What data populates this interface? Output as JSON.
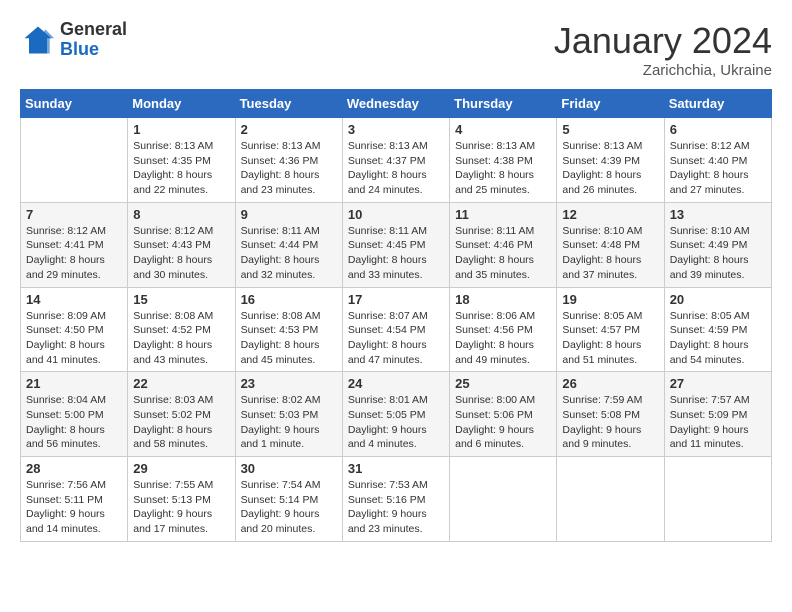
{
  "logo": {
    "general": "General",
    "blue": "Blue"
  },
  "header": {
    "title": "January 2024",
    "subtitle": "Zarichchia, Ukraine"
  },
  "weekdays": [
    "Sunday",
    "Monday",
    "Tuesday",
    "Wednesday",
    "Thursday",
    "Friday",
    "Saturday"
  ],
  "weeks": [
    [
      {
        "day": "",
        "info": ""
      },
      {
        "day": "1",
        "info": "Sunrise: 8:13 AM\nSunset: 4:35 PM\nDaylight: 8 hours\nand 22 minutes."
      },
      {
        "day": "2",
        "info": "Sunrise: 8:13 AM\nSunset: 4:36 PM\nDaylight: 8 hours\nand 23 minutes."
      },
      {
        "day": "3",
        "info": "Sunrise: 8:13 AM\nSunset: 4:37 PM\nDaylight: 8 hours\nand 24 minutes."
      },
      {
        "day": "4",
        "info": "Sunrise: 8:13 AM\nSunset: 4:38 PM\nDaylight: 8 hours\nand 25 minutes."
      },
      {
        "day": "5",
        "info": "Sunrise: 8:13 AM\nSunset: 4:39 PM\nDaylight: 8 hours\nand 26 minutes."
      },
      {
        "day": "6",
        "info": "Sunrise: 8:12 AM\nSunset: 4:40 PM\nDaylight: 8 hours\nand 27 minutes."
      }
    ],
    [
      {
        "day": "7",
        "info": "Sunrise: 8:12 AM\nSunset: 4:41 PM\nDaylight: 8 hours\nand 29 minutes."
      },
      {
        "day": "8",
        "info": "Sunrise: 8:12 AM\nSunset: 4:43 PM\nDaylight: 8 hours\nand 30 minutes."
      },
      {
        "day": "9",
        "info": "Sunrise: 8:11 AM\nSunset: 4:44 PM\nDaylight: 8 hours\nand 32 minutes."
      },
      {
        "day": "10",
        "info": "Sunrise: 8:11 AM\nSunset: 4:45 PM\nDaylight: 8 hours\nand 33 minutes."
      },
      {
        "day": "11",
        "info": "Sunrise: 8:11 AM\nSunset: 4:46 PM\nDaylight: 8 hours\nand 35 minutes."
      },
      {
        "day": "12",
        "info": "Sunrise: 8:10 AM\nSunset: 4:48 PM\nDaylight: 8 hours\nand 37 minutes."
      },
      {
        "day": "13",
        "info": "Sunrise: 8:10 AM\nSunset: 4:49 PM\nDaylight: 8 hours\nand 39 minutes."
      }
    ],
    [
      {
        "day": "14",
        "info": "Sunrise: 8:09 AM\nSunset: 4:50 PM\nDaylight: 8 hours\nand 41 minutes."
      },
      {
        "day": "15",
        "info": "Sunrise: 8:08 AM\nSunset: 4:52 PM\nDaylight: 8 hours\nand 43 minutes."
      },
      {
        "day": "16",
        "info": "Sunrise: 8:08 AM\nSunset: 4:53 PM\nDaylight: 8 hours\nand 45 minutes."
      },
      {
        "day": "17",
        "info": "Sunrise: 8:07 AM\nSunset: 4:54 PM\nDaylight: 8 hours\nand 47 minutes."
      },
      {
        "day": "18",
        "info": "Sunrise: 8:06 AM\nSunset: 4:56 PM\nDaylight: 8 hours\nand 49 minutes."
      },
      {
        "day": "19",
        "info": "Sunrise: 8:05 AM\nSunset: 4:57 PM\nDaylight: 8 hours\nand 51 minutes."
      },
      {
        "day": "20",
        "info": "Sunrise: 8:05 AM\nSunset: 4:59 PM\nDaylight: 8 hours\nand 54 minutes."
      }
    ],
    [
      {
        "day": "21",
        "info": "Sunrise: 8:04 AM\nSunset: 5:00 PM\nDaylight: 8 hours\nand 56 minutes."
      },
      {
        "day": "22",
        "info": "Sunrise: 8:03 AM\nSunset: 5:02 PM\nDaylight: 8 hours\nand 58 minutes."
      },
      {
        "day": "23",
        "info": "Sunrise: 8:02 AM\nSunset: 5:03 PM\nDaylight: 9 hours\nand 1 minute."
      },
      {
        "day": "24",
        "info": "Sunrise: 8:01 AM\nSunset: 5:05 PM\nDaylight: 9 hours\nand 4 minutes."
      },
      {
        "day": "25",
        "info": "Sunrise: 8:00 AM\nSunset: 5:06 PM\nDaylight: 9 hours\nand 6 minutes."
      },
      {
        "day": "26",
        "info": "Sunrise: 7:59 AM\nSunset: 5:08 PM\nDaylight: 9 hours\nand 9 minutes."
      },
      {
        "day": "27",
        "info": "Sunrise: 7:57 AM\nSunset: 5:09 PM\nDaylight: 9 hours\nand 11 minutes."
      }
    ],
    [
      {
        "day": "28",
        "info": "Sunrise: 7:56 AM\nSunset: 5:11 PM\nDaylight: 9 hours\nand 14 minutes."
      },
      {
        "day": "29",
        "info": "Sunrise: 7:55 AM\nSunset: 5:13 PM\nDaylight: 9 hours\nand 17 minutes."
      },
      {
        "day": "30",
        "info": "Sunrise: 7:54 AM\nSunset: 5:14 PM\nDaylight: 9 hours\nand 20 minutes."
      },
      {
        "day": "31",
        "info": "Sunrise: 7:53 AM\nSunset: 5:16 PM\nDaylight: 9 hours\nand 23 minutes."
      },
      {
        "day": "",
        "info": ""
      },
      {
        "day": "",
        "info": ""
      },
      {
        "day": "",
        "info": ""
      }
    ]
  ]
}
